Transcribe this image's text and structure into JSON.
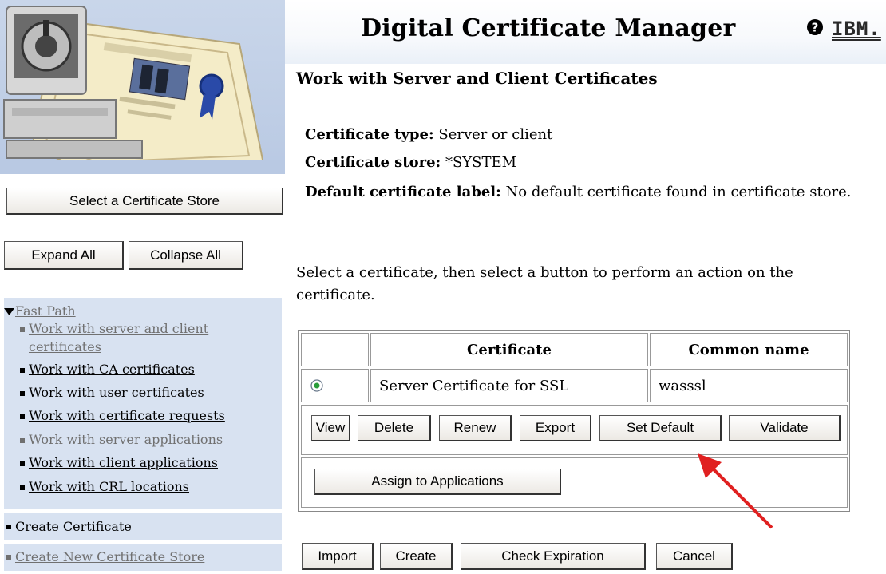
{
  "header": {
    "title": "Digital Certificate Manager",
    "help_icon": "help-icon",
    "brand": "IBM."
  },
  "sidebar": {
    "select_store_label": "Select a Certificate Store",
    "expand_all_label": "Expand All",
    "collapse_all_label": "Collapse All",
    "fast_path": {
      "label": "Fast Path",
      "items": [
        {
          "label": "Work with server and client",
          "label2": "certificates",
          "dim": true
        },
        {
          "label": "Work with CA certificates",
          "dim": false
        },
        {
          "label": "Work with user certificates",
          "dim": false
        },
        {
          "label": "Work with certificate requests",
          "dim": false
        },
        {
          "label": "Work with server applications",
          "dim": true
        },
        {
          "label": "Work with client applications",
          "dim": false
        },
        {
          "label": "Work with CRL locations",
          "dim": false
        }
      ]
    },
    "create_certificate": "Create Certificate",
    "create_store": "Create New Certificate Store"
  },
  "main": {
    "subtitle": "Work with Server and Client Certificates",
    "cert_type_label": "Certificate type:",
    "cert_type_value": "Server or client",
    "cert_store_label": "Certificate store:",
    "cert_store_value": "*SYSTEM",
    "default_label": "Default certificate label:",
    "default_value": "No default certificate found in certificate store.",
    "instruction": "Select a certificate, then select a button to perform an action on the certificate.",
    "table": {
      "col_certificate": "Certificate",
      "col_common_name": "Common name",
      "rows": [
        {
          "certificate": "Server Certificate for SSL",
          "common_name": "wasssl",
          "selected": true
        }
      ]
    },
    "row_buttons": {
      "view": "View",
      "delete": "Delete",
      "renew": "Renew",
      "export": "Export",
      "set_default": "Set Default",
      "validate": "Validate",
      "assign": "Assign to Applications"
    },
    "bottom_buttons": {
      "import": "Import",
      "create": "Create",
      "check_expiration": "Check Expiration",
      "cancel": "Cancel"
    }
  },
  "colors": {
    "nav_bg": "#d8e2f1",
    "arrow": "#e02020"
  }
}
